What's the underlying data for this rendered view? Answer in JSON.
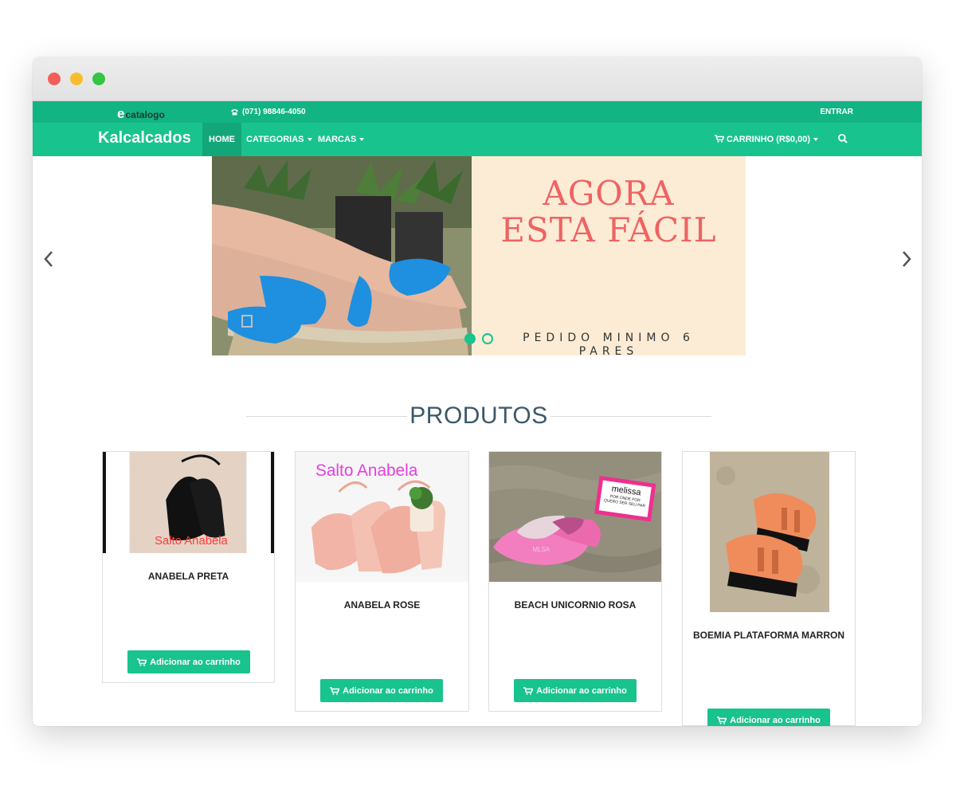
{
  "topbar": {
    "logo_e": "e",
    "logo_text": "catalogo",
    "phone": "(071) 98846-4050",
    "login": "ENTRAR"
  },
  "navbar": {
    "brand": "Kalcalcados",
    "items": [
      {
        "label": "HOME",
        "active": true
      },
      {
        "label": "CATEGORIAS",
        "dropdown": true
      },
      {
        "label": "MARCAS",
        "dropdown": true
      }
    ],
    "cart": "CARRINHO (R$0,00)"
  },
  "carousel": {
    "headline_1": "AGORA",
    "headline_2": "ESTA FÁCIL",
    "subline": "PEDIDO MINIMO 6 PARES",
    "slides_count": 2,
    "active_slide": 1
  },
  "section": {
    "title": "PRODUTOS"
  },
  "products": [
    {
      "name": "ANABELA PRETA",
      "image_label": "Salto Anabela",
      "button": "Adicionar ao carrinho"
    },
    {
      "name": "ANABELA ROSE",
      "image_label": "Salto Anabela",
      "button": "Adicionar ao carrinho"
    },
    {
      "name": "BEACH UNICORNIO ROSA",
      "image_label": "",
      "sign_brand": "melissa",
      "sign_text": "POR ONDE FOR QUERO SER SEU PAR",
      "sole_label": "MLSA",
      "button": "Adicionar ao carrinho"
    },
    {
      "name": "BOEMIA PLATAFORMA MARRON",
      "image_label": "",
      "button": "Adicionar ao carrinho"
    }
  ],
  "colors": {
    "topbar": "#12b483",
    "navbar": "#19c38d",
    "accent": "#19c38d",
    "headline": "#ee6363",
    "banner_bg": "#fdecd5"
  },
  "icons": {
    "phone": "phone-icon",
    "cart": "cart-icon",
    "search": "search-icon",
    "prev": "chevron-left-icon",
    "next": "chevron-right-icon"
  }
}
